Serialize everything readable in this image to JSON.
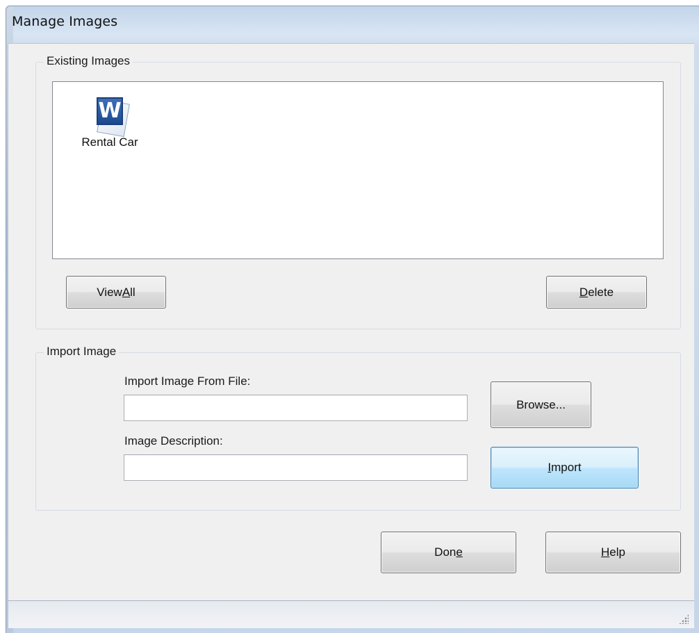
{
  "window": {
    "title": "Manage Images"
  },
  "existing_images": {
    "group_label": "Existing Images",
    "items": [
      {
        "label": "Rental Car",
        "icon": "word-document-icon"
      }
    ],
    "view_all_button": {
      "before": "View ",
      "mnemonic": "A",
      "after": "ll"
    },
    "delete_button": {
      "before": "",
      "mnemonic": "D",
      "after": "elete"
    }
  },
  "import_image": {
    "group_label": "Import Image",
    "file_label": "Import Image From File:",
    "file_value": "",
    "description_label": "Image Description:",
    "description_value": "",
    "browse_button": "Browse...",
    "import_button": {
      "before": "",
      "mnemonic": "I",
      "after": "mport"
    }
  },
  "footer": {
    "done_button": {
      "before": "Don",
      "mnemonic": "e",
      "after": ""
    },
    "help_button": {
      "before": "",
      "mnemonic": "H",
      "after": "elp"
    }
  },
  "colors": {
    "dialog_background": "#f0f0f0",
    "title_bar": "#c3d5ea",
    "focused_button_border": "#3c7fb1"
  }
}
